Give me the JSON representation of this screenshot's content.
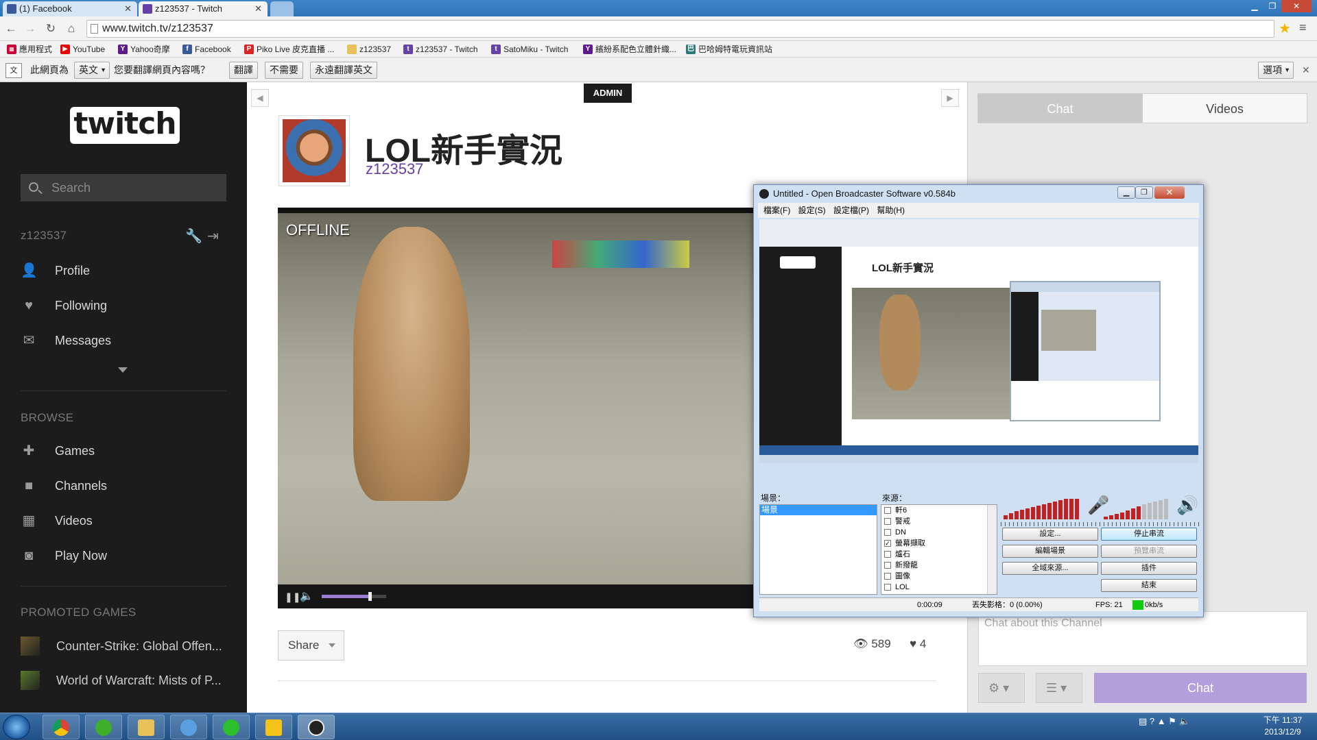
{
  "browser": {
    "tabs": [
      {
        "label": "(1) Facebook",
        "color": "#3b5998"
      },
      {
        "label": "z123537 - Twitch",
        "color": "#6441a5"
      }
    ],
    "url": "www.twitch.tv/z123537",
    "bookmarks": [
      "應用程式",
      "YouTube",
      "Yahoo奇摩",
      "Facebook",
      "Piko Live 皮克直播 ...",
      "z123537",
      "z123537 - Twitch",
      "SatoMiku - Twitch",
      "繽紛系配色立體針織...",
      "巴哈姆特電玩資訊站"
    ]
  },
  "translate_bar": {
    "prefix": "此網頁為",
    "language": "英文",
    "question": "您要翻譯網頁內容嗎？",
    "translate": "翻譯",
    "nope": "不需要",
    "never": "永遠翻譯英文",
    "options": "選項"
  },
  "sidebar": {
    "logo": "twitch",
    "search_placeholder": "Search",
    "username": "z123537",
    "user_items": [
      "Profile",
      "Following",
      "Messages"
    ],
    "browse_label": "BROWSE",
    "browse_items": [
      "Games",
      "Channels",
      "Videos",
      "Play Now"
    ],
    "promoted_label": "PROMOTED GAMES",
    "promoted": [
      "Counter-Strike: Global Offen...",
      "World of Warcraft: Mists of P..."
    ]
  },
  "main": {
    "admin_badge": "ADMIN",
    "title": "LOL新手實況",
    "channel": "z123537",
    "offline": "OFFLINE",
    "volume_level": 0.75,
    "share": "Share",
    "views": "589",
    "hearts": "4"
  },
  "right_panel": {
    "tab_chat": "Chat",
    "tab_videos": "Videos",
    "chat_placeholder": "Chat about this Channel",
    "chat_button": "Chat"
  },
  "obs": {
    "title": "Untitled - Open Broadcaster Software v0.584b",
    "menu": [
      "檔案(F)",
      "設定(S)",
      "設定檔(P)",
      "幫助(H)"
    ],
    "preview_title": "LOL新手實況",
    "scenes_label": "場景：",
    "scenes": [
      "場景"
    ],
    "sources_label": "來源：",
    "sources": [
      {
        "name": "軒6",
        "checked": false
      },
      {
        "name": "警戒",
        "checked": false
      },
      {
        "name": "DN",
        "checked": false
      },
      {
        "name": "螢幕擷取",
        "checked": true
      },
      {
        "name": "爐石",
        "checked": false
      },
      {
        "name": "新撥龍",
        "checked": false
      },
      {
        "name": "圖像",
        "checked": false
      },
      {
        "name": "LOL",
        "checked": false
      }
    ],
    "buttons": {
      "settings": "設定...",
      "stop_stream": "停止串流",
      "edit_scene": "編輯場景",
      "preview_stream": "預覽串流",
      "global_sources": "全域來源...",
      "plugins": "插件",
      "exit": "結束"
    },
    "status": {
      "time": "0:00:09",
      "dropped": "丟失影格：0 (0.00%)",
      "fps": "FPS: 21",
      "bitrate": "0kb/s"
    }
  },
  "taskbar": {
    "time": "下午 11:37",
    "date": "2013/12/9"
  }
}
